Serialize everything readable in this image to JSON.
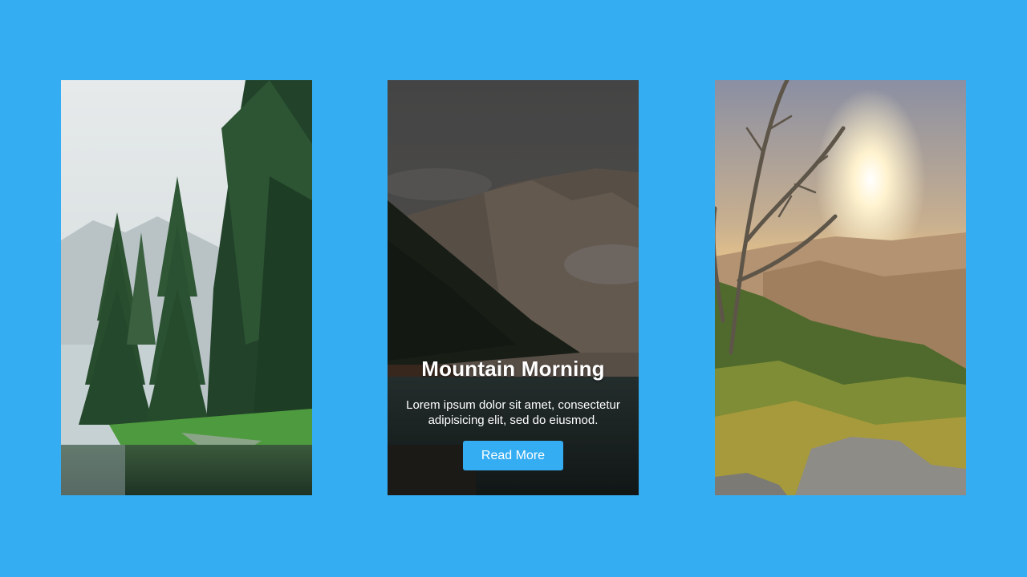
{
  "colors": {
    "background": "#35adf3",
    "button": "#35adf3",
    "text": "#ffffff"
  },
  "cards": [
    {
      "image": "forest-lake-photo"
    },
    {
      "image": "mountain-lake-photo",
      "title": "Mountain Morning",
      "text": "Lorem ipsum dolor sit amet, consectetur adipisicing elit, sed do eiusmod.",
      "button_label": "Read More"
    },
    {
      "image": "sunset-valley-photo"
    }
  ]
}
